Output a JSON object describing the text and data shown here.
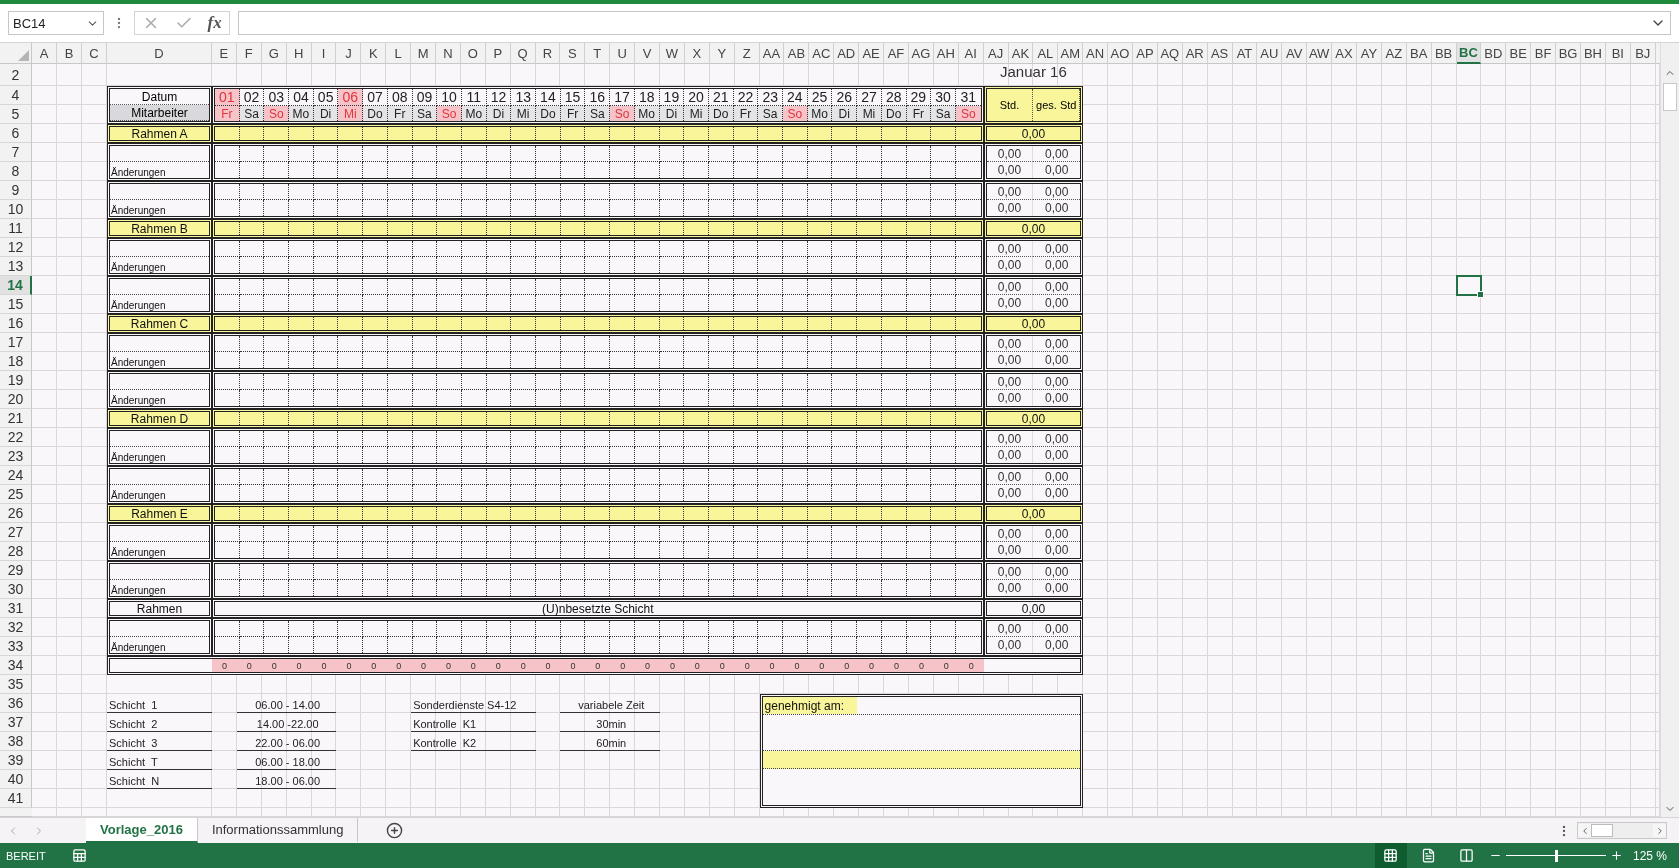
{
  "formula_bar": {
    "name_box": "BC14",
    "function_label": "fx"
  },
  "column_headers": [
    {
      "label": "A",
      "selected": false
    },
    {
      "label": "B",
      "selected": false
    },
    {
      "label": "C",
      "selected": false
    },
    {
      "label": "D",
      "selected": false
    },
    {
      "label": "E",
      "selected": false
    },
    {
      "label": "F",
      "selected": false
    },
    {
      "label": "G",
      "selected": false
    },
    {
      "label": "H",
      "selected": false
    },
    {
      "label": "I",
      "selected": false
    },
    {
      "label": "J",
      "selected": false
    },
    {
      "label": "K",
      "selected": false
    },
    {
      "label": "L",
      "selected": false
    },
    {
      "label": "M",
      "selected": false
    },
    {
      "label": "N",
      "selected": false
    },
    {
      "label": "O",
      "selected": false
    },
    {
      "label": "P",
      "selected": false
    },
    {
      "label": "Q",
      "selected": false
    },
    {
      "label": "R",
      "selected": false
    },
    {
      "label": "S",
      "selected": false
    },
    {
      "label": "T",
      "selected": false
    },
    {
      "label": "U",
      "selected": false
    },
    {
      "label": "V",
      "selected": false
    },
    {
      "label": "W",
      "selected": false
    },
    {
      "label": "X",
      "selected": false
    },
    {
      "label": "Y",
      "selected": false
    },
    {
      "label": "Z",
      "selected": false
    },
    {
      "label": "AA",
      "selected": false
    },
    {
      "label": "AB",
      "selected": false
    },
    {
      "label": "AC",
      "selected": false
    },
    {
      "label": "AD",
      "selected": false
    },
    {
      "label": "AE",
      "selected": false
    },
    {
      "label": "AF",
      "selected": false
    },
    {
      "label": "AG",
      "selected": false
    },
    {
      "label": "AH",
      "selected": false
    },
    {
      "label": "AI",
      "selected": false
    },
    {
      "label": "AJ",
      "selected": false
    },
    {
      "label": "AK",
      "selected": false
    },
    {
      "label": "AL",
      "selected": false
    },
    {
      "label": "AM",
      "selected": false
    },
    {
      "label": "AN",
      "selected": false
    },
    {
      "label": "AO",
      "selected": false
    },
    {
      "label": "AP",
      "selected": false
    },
    {
      "label": "AQ",
      "selected": false
    },
    {
      "label": "AR",
      "selected": false
    },
    {
      "label": "AS",
      "selected": false
    },
    {
      "label": "AT",
      "selected": false
    },
    {
      "label": "AU",
      "selected": false
    },
    {
      "label": "AV",
      "selected": false
    },
    {
      "label": "AW",
      "selected": false
    },
    {
      "label": "AX",
      "selected": false
    },
    {
      "label": "AY",
      "selected": false
    },
    {
      "label": "AZ",
      "selected": false
    },
    {
      "label": "BA",
      "selected": false
    },
    {
      "label": "BB",
      "selected": false
    },
    {
      "label": "BC",
      "selected": true
    },
    {
      "label": "BD",
      "selected": false
    },
    {
      "label": "BE",
      "selected": false
    },
    {
      "label": "BF",
      "selected": false
    },
    {
      "label": "BG",
      "selected": false
    },
    {
      "label": "BH",
      "selected": false
    },
    {
      "label": "BI",
      "selected": false
    },
    {
      "label": "BJ",
      "selected": false
    }
  ],
  "row_headers": [
    {
      "label": "2",
      "selected": false
    },
    {
      "label": "4",
      "selected": false
    },
    {
      "label": "5",
      "selected": false
    },
    {
      "label": "6",
      "selected": false
    },
    {
      "label": "7",
      "selected": false
    },
    {
      "label": "8",
      "selected": false
    },
    {
      "label": "9",
      "selected": false
    },
    {
      "label": "10",
      "selected": false
    },
    {
      "label": "11",
      "selected": false
    },
    {
      "label": "12",
      "selected": false
    },
    {
      "label": "13",
      "selected": false
    },
    {
      "label": "14",
      "selected": true
    },
    {
      "label": "15",
      "selected": false
    },
    {
      "label": "16",
      "selected": false
    },
    {
      "label": "17",
      "selected": false
    },
    {
      "label": "18",
      "selected": false
    },
    {
      "label": "19",
      "selected": false
    },
    {
      "label": "20",
      "selected": false
    },
    {
      "label": "21",
      "selected": false
    },
    {
      "label": "22",
      "selected": false
    },
    {
      "label": "23",
      "selected": false
    },
    {
      "label": "24",
      "selected": false
    },
    {
      "label": "25",
      "selected": false
    },
    {
      "label": "26",
      "selected": false
    },
    {
      "label": "27",
      "selected": false
    },
    {
      "label": "28",
      "selected": false
    },
    {
      "label": "29",
      "selected": false
    },
    {
      "label": "30",
      "selected": false
    },
    {
      "label": "31",
      "selected": false
    },
    {
      "label": "32",
      "selected": false
    },
    {
      "label": "33",
      "selected": false
    },
    {
      "label": "34",
      "selected": false
    },
    {
      "label": "35",
      "selected": false
    },
    {
      "label": "36",
      "selected": false
    },
    {
      "label": "37",
      "selected": false
    },
    {
      "label": "38",
      "selected": false
    },
    {
      "label": "39",
      "selected": false
    },
    {
      "label": "40",
      "selected": false
    },
    {
      "label": "41",
      "selected": false
    }
  ],
  "title": "Januar 16",
  "schedule": {
    "date_label": "Datum",
    "employee_label": "Mitarbeiter",
    "std_label": "Std.",
    "total_label": "ges. Std",
    "days": [
      {
        "date": "01",
        "weekday": "Fr",
        "holiday": true,
        "sunday": false
      },
      {
        "date": "02",
        "weekday": "Sa",
        "holiday": false,
        "sunday": false
      },
      {
        "date": "03",
        "weekday": "So",
        "holiday": false,
        "sunday": true
      },
      {
        "date": "04",
        "weekday": "Mo",
        "holiday": false,
        "sunday": false
      },
      {
        "date": "05",
        "weekday": "Di",
        "holiday": false,
        "sunday": false
      },
      {
        "date": "06",
        "weekday": "Mi",
        "holiday": true,
        "sunday": false
      },
      {
        "date": "07",
        "weekday": "Do",
        "holiday": false,
        "sunday": false
      },
      {
        "date": "08",
        "weekday": "Fr",
        "holiday": false,
        "sunday": false
      },
      {
        "date": "09",
        "weekday": "Sa",
        "holiday": false,
        "sunday": false
      },
      {
        "date": "10",
        "weekday": "So",
        "holiday": false,
        "sunday": true
      },
      {
        "date": "11",
        "weekday": "Mo",
        "holiday": false,
        "sunday": false
      },
      {
        "date": "12",
        "weekday": "Di",
        "holiday": false,
        "sunday": false
      },
      {
        "date": "13",
        "weekday": "Mi",
        "holiday": false,
        "sunday": false
      },
      {
        "date": "14",
        "weekday": "Do",
        "holiday": false,
        "sunday": false
      },
      {
        "date": "15",
        "weekday": "Fr",
        "holiday": false,
        "sunday": false
      },
      {
        "date": "16",
        "weekday": "Sa",
        "holiday": false,
        "sunday": false
      },
      {
        "date": "17",
        "weekday": "So",
        "holiday": false,
        "sunday": true
      },
      {
        "date": "18",
        "weekday": "Mo",
        "holiday": false,
        "sunday": false
      },
      {
        "date": "19",
        "weekday": "Di",
        "holiday": false,
        "sunday": false
      },
      {
        "date": "20",
        "weekday": "Mi",
        "holiday": false,
        "sunday": false
      },
      {
        "date": "21",
        "weekday": "Do",
        "holiday": false,
        "sunday": false
      },
      {
        "date": "22",
        "weekday": "Fr",
        "holiday": false,
        "sunday": false
      },
      {
        "date": "23",
        "weekday": "Sa",
        "holiday": false,
        "sunday": false
      },
      {
        "date": "24",
        "weekday": "So",
        "holiday": false,
        "sunday": true
      },
      {
        "date": "25",
        "weekday": "Mo",
        "holiday": false,
        "sunday": false
      },
      {
        "date": "26",
        "weekday": "Di",
        "holiday": false,
        "sunday": false
      },
      {
        "date": "27",
        "weekday": "Mi",
        "holiday": false,
        "sunday": false
      },
      {
        "date": "28",
        "weekday": "Do",
        "holiday": false,
        "sunday": false
      },
      {
        "date": "29",
        "weekday": "Fr",
        "holiday": false,
        "sunday": false
      },
      {
        "date": "30",
        "weekday": "Sa",
        "holiday": false,
        "sunday": false
      },
      {
        "date": "31",
        "weekday": "So",
        "holiday": false,
        "sunday": true
      }
    ],
    "groups": [
      {
        "label": "Rahmen A",
        "total": "0,00",
        "blocks": [
          {
            "note": "Änderungen",
            "hours": [
              {
                "std": "0,00",
                "total": "0,00"
              },
              {
                "std": "0,00",
                "total": "0,00"
              }
            ]
          },
          {
            "note": "Änderungen",
            "hours": [
              {
                "std": "0,00",
                "total": "0,00"
              },
              {
                "std": "0,00",
                "total": "0,00"
              }
            ]
          }
        ]
      },
      {
        "label": "Rahmen B",
        "total": "0,00",
        "blocks": [
          {
            "note": "Änderungen",
            "hours": [
              {
                "std": "0,00",
                "total": "0,00"
              },
              {
                "std": "0,00",
                "total": "0,00"
              }
            ]
          },
          {
            "note": "Änderungen",
            "hours": [
              {
                "std": "0,00",
                "total": "0,00"
              },
              {
                "std": "0,00",
                "total": "0,00"
              }
            ]
          }
        ]
      },
      {
        "label": "Rahmen C",
        "total": "0,00",
        "blocks": [
          {
            "note": "Änderungen",
            "hours": [
              {
                "std": "0,00",
                "total": "0,00"
              },
              {
                "std": "0,00",
                "total": "0,00"
              }
            ]
          },
          {
            "note": "Änderungen",
            "hours": [
              {
                "std": "0,00",
                "total": "0,00"
              },
              {
                "std": "0,00",
                "total": "0,00"
              }
            ]
          }
        ]
      },
      {
        "label": "Rahmen D",
        "total": "0,00",
        "blocks": [
          {
            "note": "Änderungen",
            "hours": [
              {
                "std": "0,00",
                "total": "0,00"
              },
              {
                "std": "0,00",
                "total": "0,00"
              }
            ]
          },
          {
            "note": "Änderungen",
            "hours": [
              {
                "std": "0,00",
                "total": "0,00"
              },
              {
                "std": "0,00",
                "total": "0,00"
              }
            ]
          }
        ]
      },
      {
        "label": "Rahmen E",
        "total": "0,00",
        "blocks": [
          {
            "note": "Änderungen",
            "hours": [
              {
                "std": "0,00",
                "total": "0,00"
              },
              {
                "std": "0,00",
                "total": "0,00"
              }
            ]
          },
          {
            "note": "Änderungen",
            "hours": [
              {
                "std": "0,00",
                "total": "0,00"
              },
              {
                "std": "0,00",
                "total": "0,00"
              }
            ]
          }
        ]
      }
    ],
    "unstaffed": {
      "label": "Rahmen",
      "text": "(U)nbesetzte Schicht",
      "total": "0,00",
      "blocks": [
        {
          "note": "Änderungen",
          "hours": [
            {
              "std": "0,00",
              "total": "0,00"
            },
            {
              "std": "0,00",
              "total": "0,00"
            }
          ]
        }
      ]
    },
    "day_totals": [
      "0",
      "0",
      "0",
      "0",
      "0",
      "0",
      "0",
      "0",
      "0",
      "0",
      "0",
      "0",
      "0",
      "0",
      "0",
      "0",
      "0",
      "0",
      "0",
      "0",
      "0",
      "0",
      "0",
      "0",
      "0",
      "0",
      "0",
      "0",
      "0",
      "0",
      "0"
    ]
  },
  "shifts": [
    {
      "name": "Schicht  1",
      "time": "06.00 - 14.00"
    },
    {
      "name": "Schicht  2",
      "time": "14.00 -22.00"
    },
    {
      "name": "Schicht  3",
      "time": "22.00 - 06.00"
    },
    {
      "name": "Schicht  T",
      "time": "06.00 - 18.00"
    },
    {
      "name": "Schicht  N",
      "time": "18.00 - 06.00"
    }
  ],
  "special_services": [
    {
      "name": "Sonderdienste S4-12",
      "time": "variabele Zeit"
    },
    {
      "name": "Kontrolle  K1",
      "time": "30min"
    },
    {
      "name": "Kontrolle  K2",
      "time": "60min"
    }
  ],
  "approval": {
    "label": "genehmigt am:"
  },
  "sheet_tabs": [
    {
      "label": "Vorlage_2016",
      "selected": true
    },
    {
      "label": "Informationssammlung",
      "selected": false
    }
  ],
  "status_bar": {
    "status": "BEREIT",
    "views": [
      {
        "kind": "normal",
        "selected": true
      },
      {
        "kind": "page-layout",
        "selected": false
      },
      {
        "kind": "page-break",
        "selected": false
      }
    ],
    "zoom_slider": {
      "level": 0.5
    },
    "zoom": "125 %"
  }
}
